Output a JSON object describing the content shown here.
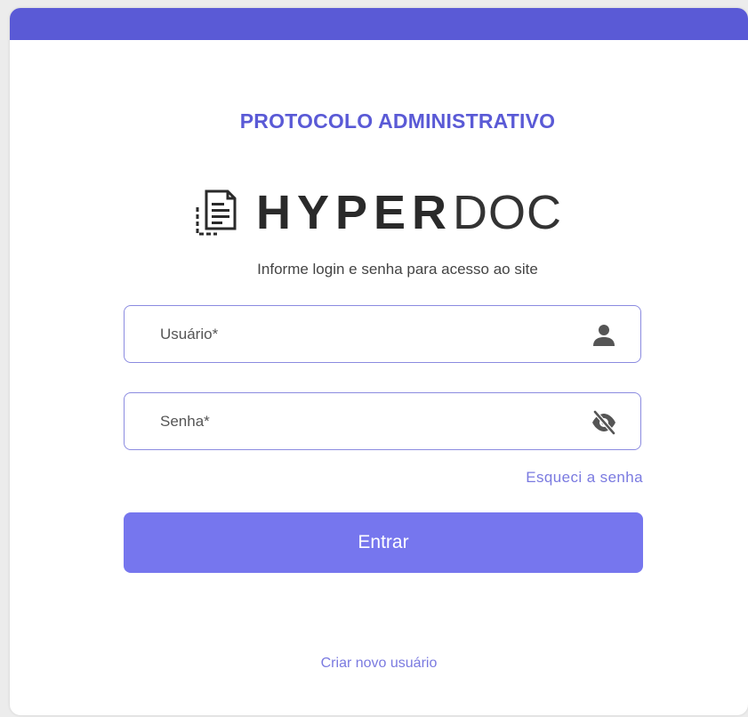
{
  "header": {
    "title": "PROTOCOLO ADMINISTRATIVO"
  },
  "logo": {
    "text_bold": "HYPER",
    "text_light": "DOC",
    "icon": "document-stack-icon"
  },
  "subtitle": "Informe login e senha para acesso ao site",
  "form": {
    "username": {
      "placeholder": "Usuário*",
      "value": "",
      "icon": "user-icon"
    },
    "password": {
      "placeholder": "Senha*",
      "value": "",
      "icon": "eye-off-icon"
    },
    "forgot_link": "Esqueci a senha",
    "submit_label": "Entrar"
  },
  "footer": {
    "create_user_link": "Criar novo usuário"
  },
  "colors": {
    "accent": "#5a5ad6",
    "button": "#7676ee",
    "link": "#7a7ae0"
  }
}
